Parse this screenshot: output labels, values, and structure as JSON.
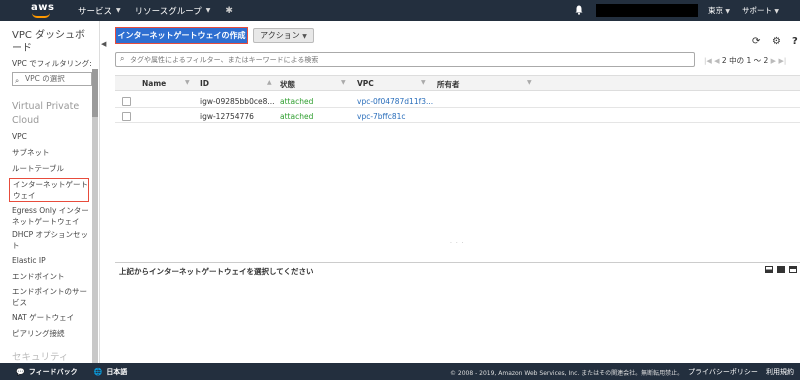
{
  "topbar": {
    "logo_text": "aws",
    "services": "サービス",
    "resource_groups": "リソースグループ",
    "region": "東京",
    "support": "サポート"
  },
  "sidebar": {
    "title": "VPC ダッシュボード",
    "filter_label": "VPC でフィルタリング:",
    "vpc_select_placeholder": "VPC の選択",
    "section_virtual_private_cloud": "Virtual Private Cloud",
    "items": [
      "VPC",
      "サブネット",
      "ルートテーブル",
      "インターネットゲートウェイ",
      "Egress Only インターネットゲートウェイ",
      "DHCP オプションセット",
      "Elastic IP",
      "エンドポイント",
      "エンドポイントのサービス",
      "NAT ゲートウェイ",
      "ピアリング接続"
    ],
    "section_security": "セキュリティ",
    "active_index": 3
  },
  "toolbar": {
    "create_button": "インターネットゲートウェイの作成",
    "actions_button": "アクション"
  },
  "search": {
    "placeholder": "タグや属性によるフィルター、またはキーワードによる検索"
  },
  "pagination": {
    "text": "2 中の 1 ～ 2"
  },
  "table": {
    "columns": [
      "Name",
      "ID",
      "状態",
      "VPC",
      "所有者"
    ],
    "rows": [
      {
        "name": "",
        "id": "igw-09285bb0ce8...",
        "state": "attached",
        "vpc": "vpc-0f04787d11f3...",
        "owner": ""
      },
      {
        "name": "",
        "id": "igw-12754776",
        "state": "attached",
        "vpc": "vpc-7bffc81c",
        "owner": ""
      }
    ]
  },
  "detail": {
    "message": "上記からインターネットゲートウェイを選択してください"
  },
  "footer": {
    "feedback": "フィードバック",
    "language": "日本語",
    "copyright": "© 2008 - 2019, Amazon Web Services, Inc. またはその関連会社。無断転用禁止。",
    "privacy": "プライバシーポリシー",
    "terms": "利用規約"
  },
  "colors": {
    "nav_bg": "#232f3e",
    "primary_button": "#2e6fd1",
    "highlight_border": "#e74c3c",
    "attached_status": "#2e9e2e",
    "link": "#2a6ebb"
  }
}
